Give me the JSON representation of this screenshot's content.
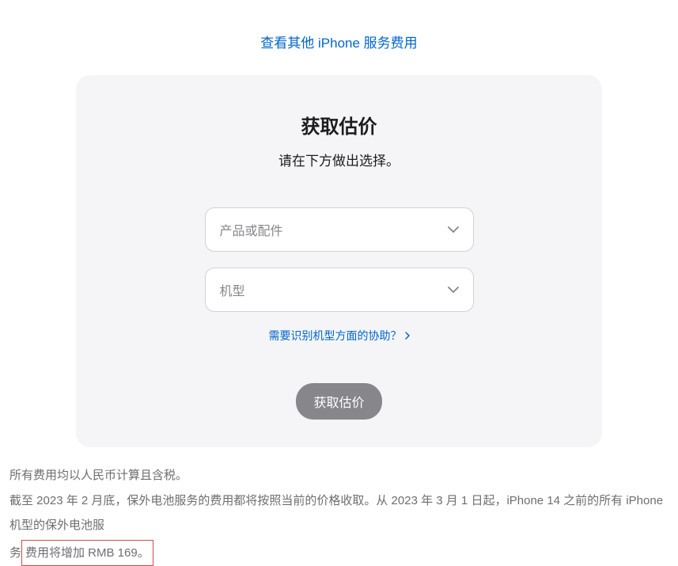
{
  "top_link": "查看其他 iPhone 服务费用",
  "card": {
    "title": "获取估价",
    "subtitle": "请在下方做出选择。",
    "select_product": "产品或配件",
    "select_model": "机型",
    "help_link": "需要识别机型方面的协助？",
    "submit": "获取估价"
  },
  "footer": {
    "line1": "所有费用均以人民币计算且含税。",
    "line2_part1": "截至 2023 年 2 月底，保外电池服务的费用都将按照当前的价格收取。从 2023 年 3 月 1 日起，iPhone 14 之前的所有 iPhone 机型的保外电池服",
    "line2_part2_prefix": "务",
    "line2_highlight": "费用将增加 RMB 169。"
  }
}
